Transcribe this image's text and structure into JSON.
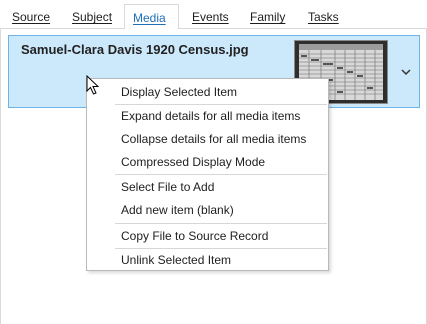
{
  "tabs": [
    {
      "label": "Source",
      "active": false
    },
    {
      "label": "Subject",
      "active": false
    },
    {
      "label": "Media",
      "active": true
    },
    {
      "label": "Events",
      "active": false
    },
    {
      "label": "Family",
      "active": false
    },
    {
      "label": "Tasks",
      "active": false
    }
  ],
  "media": {
    "items": [
      {
        "title": "Samuel-Clara Davis 1920 Census.jpg",
        "thumbnail_icon": "census-document-thumbnail"
      }
    ]
  },
  "context_menu": {
    "items": [
      {
        "label": "Display Selected Item"
      },
      {
        "label": "Expand details for all media items"
      },
      {
        "label": "Collapse details for all media items"
      },
      {
        "label": "Compressed Display Mode"
      },
      {
        "label": "Select File to Add"
      },
      {
        "label": "Add new item (blank)"
      },
      {
        "label": "Copy File to Source Record"
      },
      {
        "label": "Unlink Selected Item"
      }
    ]
  },
  "colors": {
    "accent": "#1f6fb5",
    "selection_fill": "#cce8fb",
    "selection_border": "#6fb4e8"
  }
}
